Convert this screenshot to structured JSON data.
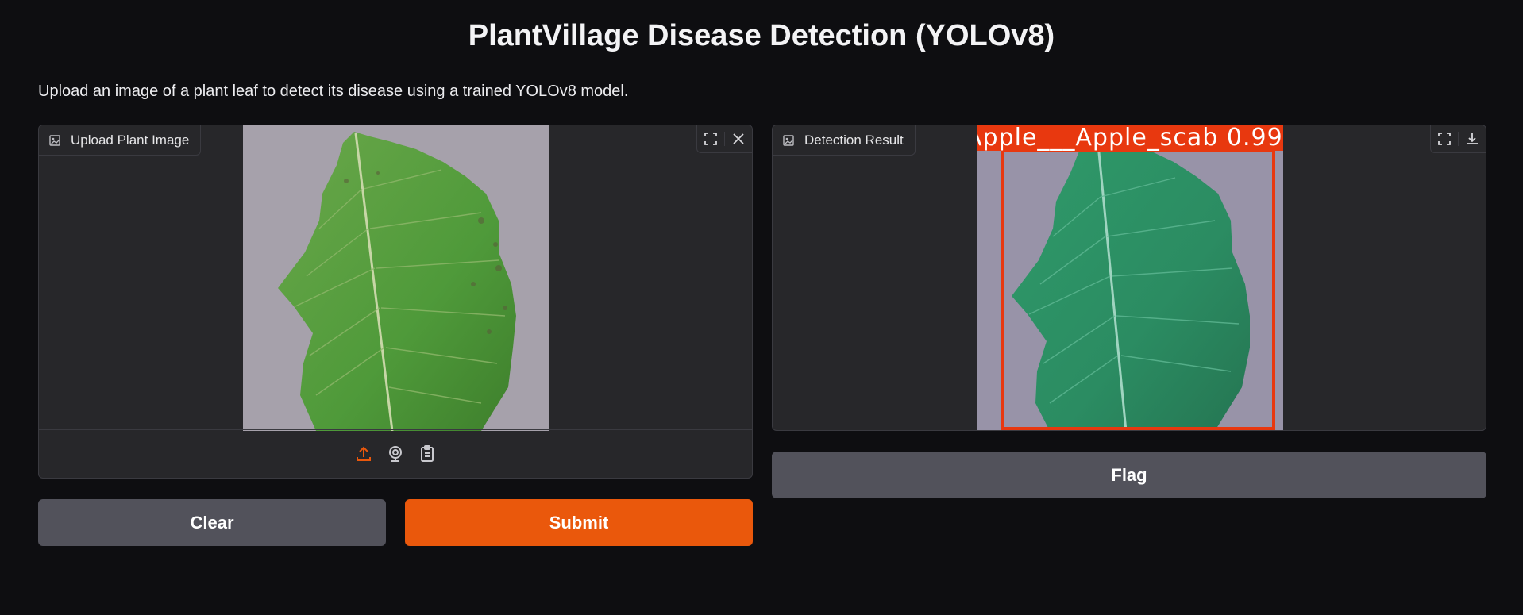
{
  "page": {
    "title": "PlantVillage Disease Detection (YOLOv8)",
    "description": "Upload an image of a plant leaf to detect its disease using a trained YOLOv8 model."
  },
  "input_panel": {
    "label": "Upload Plant Image",
    "tools": [
      "fullscreen-icon",
      "close-icon"
    ],
    "sources": [
      "upload-icon",
      "webcam-icon",
      "clipboard-icon"
    ],
    "accent_color": "#ea580c"
  },
  "output_panel": {
    "label": "Detection Result",
    "tools": [
      "fullscreen-icon",
      "download-icon"
    ],
    "detection_label": "Apple___Apple_scab 0.99",
    "box_color": "#e8380f"
  },
  "buttons": {
    "clear": "Clear",
    "submit": "Submit",
    "flag": "Flag"
  }
}
